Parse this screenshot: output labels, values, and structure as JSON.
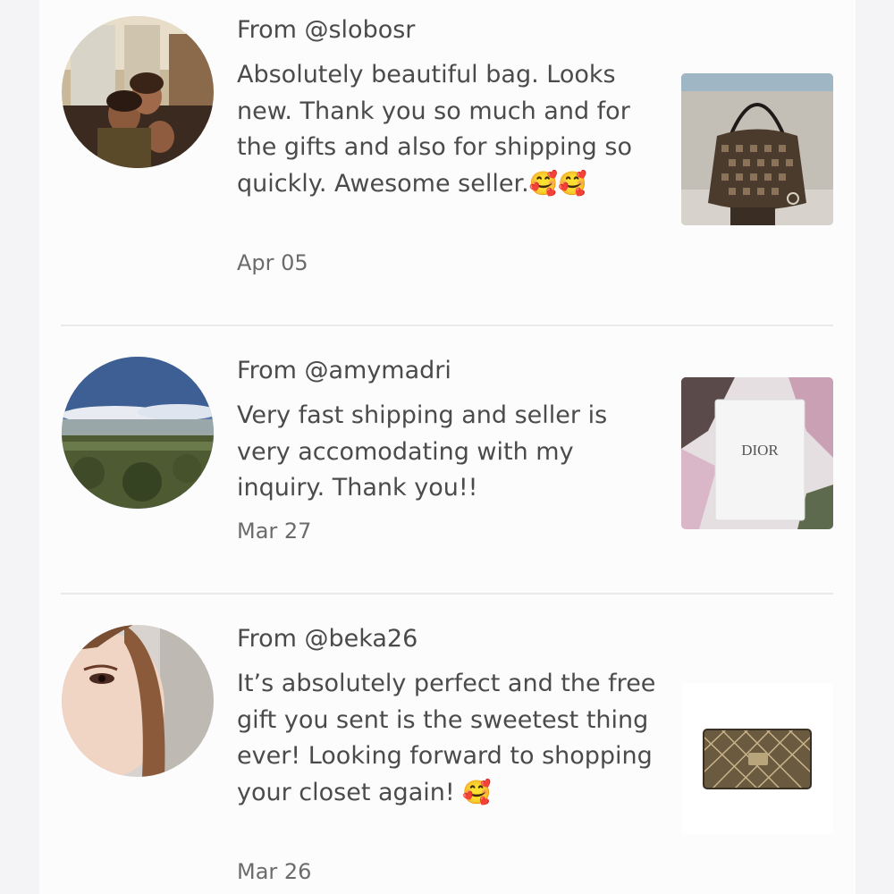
{
  "reviews": [
    {
      "from": "From @slobosr",
      "text": "Absolutely beautiful bag. Looks new. Thank you so much and for the gifts and also for shipping so quickly. Awesome seller.",
      "emoji": "🥰🥰",
      "date": "Apr 05"
    },
    {
      "from": "From @amymadri",
      "text": "Very fast shipping and seller is very accomodating with my inquiry. Thank you!!",
      "emoji": "",
      "date": "Mar 27"
    },
    {
      "from": "From @beka26",
      "text": "It’s absolutely perfect and the free gift you sent is the sweetest thing ever! Looking forward to shopping your closet again! ",
      "emoji": "🥰",
      "date": "Mar 26"
    }
  ],
  "thumb_labels": {
    "dior_box": "DIOR"
  },
  "icons": {
    "review_1_avatar": "avatar-photo-icon",
    "review_2_avatar": "avatar-landscape-icon",
    "review_3_avatar": "avatar-portrait-icon",
    "review_1_item": "handbag-photo",
    "review_2_item": "dior-box-photo",
    "review_3_item": "wallet-photo"
  },
  "colors": {
    "page_background": "#f4f3f5",
    "panel_background": "#fdfcfd",
    "text_primary": "#4b4b4b",
    "text_muted": "#6b6b6b",
    "divider": "#ebe9ec"
  }
}
